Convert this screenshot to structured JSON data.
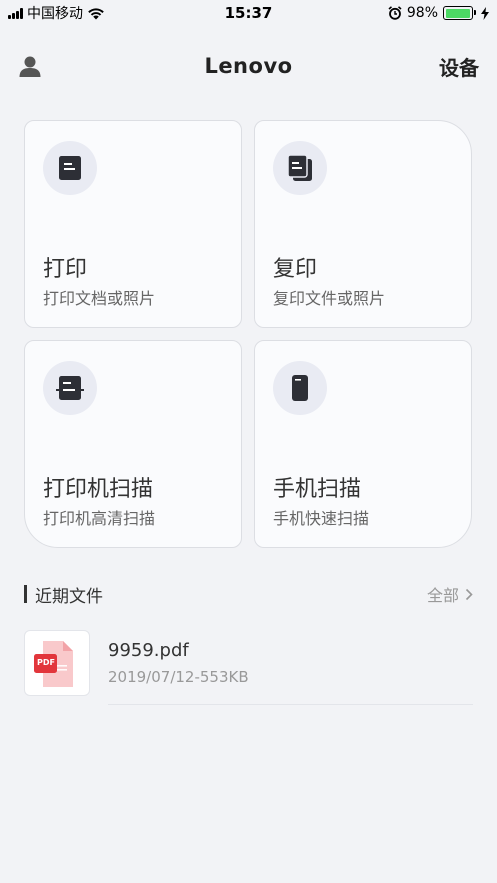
{
  "status_bar": {
    "carrier": "中国移动",
    "time": "15:37",
    "battery": "98%",
    "battery_level": 0.98,
    "icons": [
      "signal-icon",
      "wifi-icon",
      "alarm-icon",
      "battery-icon",
      "charging-icon"
    ]
  },
  "header": {
    "title": "Lenovo",
    "right_label": "设备",
    "left_icon": "user-icon"
  },
  "cards": [
    {
      "title": "打印",
      "subtitle": "打印文档或照片",
      "icon": "document-print-icon"
    },
    {
      "title": "复印",
      "subtitle": "复印文件或照片",
      "icon": "copy-icon"
    },
    {
      "title": "打印机扫描",
      "subtitle": "打印机高清扫描",
      "icon": "printer-scan-icon"
    },
    {
      "title": "手机扫描",
      "subtitle": "手机快速扫描",
      "icon": "phone-scan-icon"
    }
  ],
  "recent": {
    "title": "近期文件",
    "more_label": "全部",
    "files": [
      {
        "name": "9959.pdf",
        "meta": "2019/07/12-553KB",
        "badge": "PDF"
      }
    ]
  },
  "colors": {
    "background": "#f2f3f6",
    "card": "#fafbfd",
    "icon_circle": "#e9ebf3",
    "icon_dark": "#2d2f36",
    "pdf_red": "#e2363c",
    "battery_green": "#4cd964"
  }
}
